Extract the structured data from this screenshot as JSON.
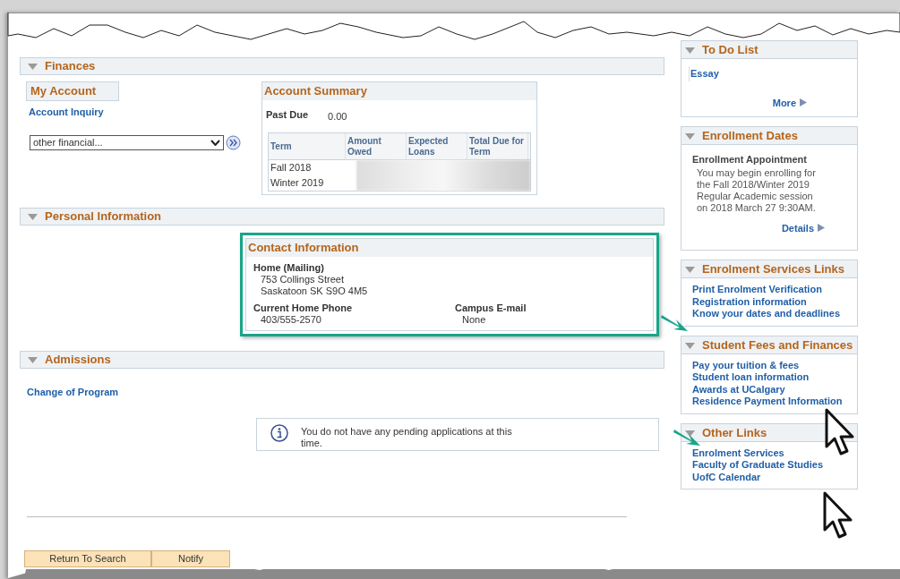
{
  "finances": {
    "title": "Finances",
    "expanded": true,
    "my_account": {
      "title": "My Account",
      "links": [
        "Account Inquiry"
      ]
    },
    "dropdown": {
      "value": "other financial..."
    },
    "account_summary": {
      "title": "Account Summary",
      "past_due_label": "Past Due",
      "past_due_value": "0.00",
      "columns": [
        "Term",
        "Amount Owed",
        "Expected Loans",
        "Total Due for Term"
      ],
      "rows": [
        {
          "term": "Fall 2018"
        },
        {
          "term": "Winter 2019"
        }
      ]
    }
  },
  "personal_information": {
    "title": "Personal Information",
    "expanded": true,
    "contact": {
      "title": "Contact Information",
      "highlighted": true,
      "home_label": "Home (Mailing)",
      "address_lines": [
        "753 Collings Street",
        "Saskatoon SK S9O 4M5"
      ],
      "phone_label": "Current Home Phone",
      "phone": "403/555-2570",
      "email_label": "Campus E-mail",
      "email": "None"
    }
  },
  "admissions": {
    "title": "Admissions",
    "expanded": true,
    "link": "Change of Program",
    "message": "You do not have any pending applications at this time."
  },
  "buttons": [
    "Return To Search",
    "Notify"
  ],
  "sidebar": [
    {
      "kind": "todo",
      "title": "To Do List",
      "expanded": true,
      "items": [
        "Essay"
      ],
      "more": "More"
    },
    {
      "kind": "appointment",
      "title": "Enrollment Dates",
      "expanded": true,
      "heading": "Enrollment Appointment",
      "text": "You may begin enrolling for the Fall 2018/Winter 2019 Regular Academic session on 2018 March 27 9:30AM.",
      "more": "Details"
    },
    {
      "kind": "links",
      "title": "Enrolment Services Links",
      "expanded": true,
      "links": [
        "Print Enrolment Verification",
        "Registration information",
        "Know your dates and deadlines"
      ]
    },
    {
      "kind": "links",
      "title": "Student Fees and Finances",
      "expanded": true,
      "links": [
        "Pay your tuition & fees",
        "Student loan information",
        "Awards at UCalgary",
        "Residence Payment Information"
      ]
    },
    {
      "kind": "links",
      "title": "Other Links",
      "expanded": true,
      "links": [
        "Enrolment Services",
        "Faculty of Graduate Studies",
        "UofC Calendar"
      ]
    }
  ]
}
